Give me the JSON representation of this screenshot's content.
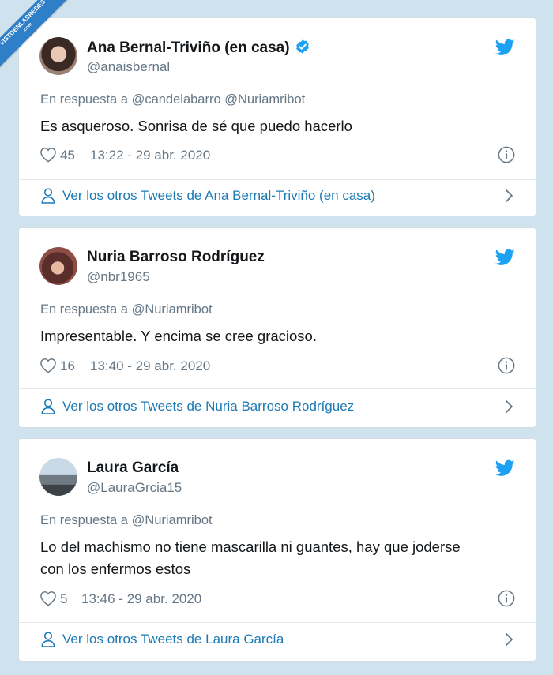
{
  "watermark": {
    "line1": "VISTOENLASREDES",
    "line2": ".com"
  },
  "colors": {
    "page_background": "#cfe3ee",
    "card_background": "#ffffff",
    "text_primary": "#14171a",
    "text_secondary": "#657786",
    "link_blue": "#1b7ab5",
    "twitter_blue": "#1da1f2"
  },
  "icons": {
    "verified": "verified-badge-icon",
    "brand": "twitter-bird-icon",
    "like": "heart-icon",
    "info": "info-icon",
    "profile": "person-icon",
    "next": "chevron-right-icon"
  },
  "tweets": [
    {
      "name": "Ana Bernal-Triviño (en casa)",
      "verified": true,
      "handle": "@anaisbernal",
      "reply_to": "En respuesta a @candelabarro @Nuriamribot",
      "text": "Es asqueroso. Sonrisa de sé que puedo hacerlo",
      "likes": "45",
      "timestamp": "13:22 - 29 abr. 2020",
      "more_tweets": "Ver los otros Tweets de Ana Bernal-Triviño (en casa)"
    },
    {
      "name": "Nuria Barroso Rodríguez",
      "verified": false,
      "handle": "@nbr1965",
      "reply_to": "En respuesta a @Nuriamribot",
      "text": "Impresentable. Y encima se cree gracioso.",
      "likes": "16",
      "timestamp": "13:40 - 29 abr. 2020",
      "more_tweets": "Ver los otros Tweets de Nuria Barroso Rodríguez"
    },
    {
      "name": "Laura García",
      "verified": false,
      "handle": "@LauraGrcia15",
      "reply_to": "En respuesta a @Nuriamribot",
      "text": "Lo del machismo no tiene mascarilla ni guantes, hay que joderse con los enfermos estos",
      "likes": "5",
      "timestamp": "13:46 - 29 abr. 2020",
      "more_tweets": "Ver los otros Tweets de Laura García"
    }
  ]
}
